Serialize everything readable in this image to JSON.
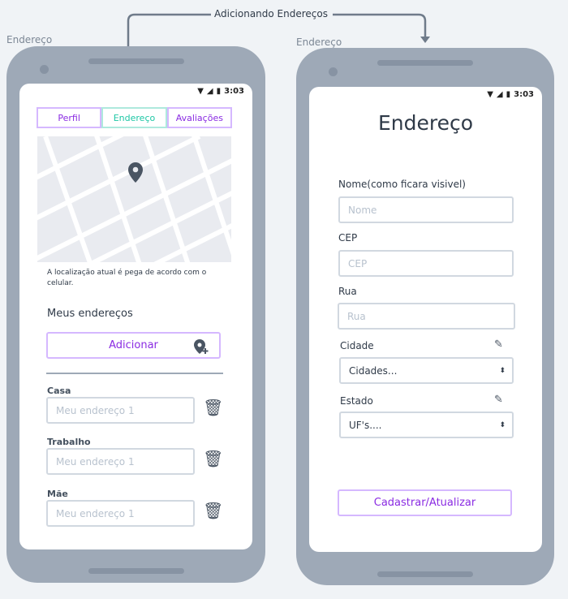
{
  "flow_label": "Adicionando Endereços",
  "left": {
    "caption": "Endereço",
    "time": "3:03",
    "tabs": [
      "Perfil",
      "Endereço",
      "Avaliações"
    ],
    "active_tab": 1,
    "map_note": "A localização atual é pega de acordo com o celular.",
    "section_title": "Meus endereços",
    "add_button": "Adicionar",
    "addresses": [
      {
        "label": "Casa",
        "placeholder": "Meu endereço 1"
      },
      {
        "label": "Trabalho",
        "placeholder": "Meu endereço 1"
      },
      {
        "label": "Mãe",
        "placeholder": "Meu endereço 1"
      }
    ]
  },
  "right": {
    "caption": "Endereço",
    "time": "3:03",
    "title": "Endereço",
    "fields": [
      {
        "label": "Nome(como ficara visivel)",
        "placeholder": "Nome"
      },
      {
        "label": "CEP",
        "placeholder": "CEP"
      },
      {
        "label": "Rua",
        "placeholder": "Rua"
      }
    ],
    "city": {
      "label": "Cidade",
      "value": "Cidades..."
    },
    "state": {
      "label": "Estado",
      "value": "UF's...."
    },
    "submit": "Cadastrar/Atualizar"
  },
  "colors": {
    "accent": "#8a2be2",
    "active_tab": "#1ec7a5",
    "frame": "#9ea9b7"
  }
}
